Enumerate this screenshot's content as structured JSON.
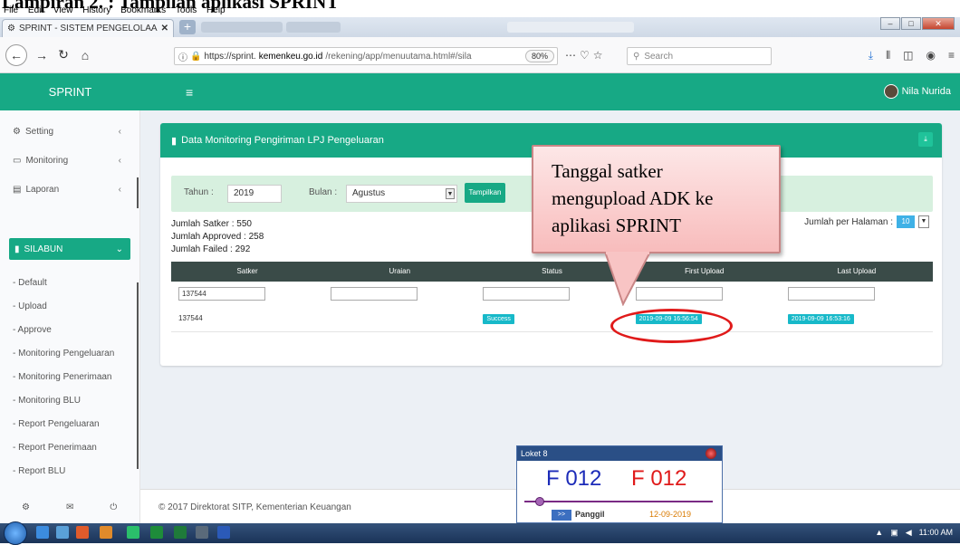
{
  "doc_heading": "Lampiran 2. : Tampilan aplikasi SPRINT",
  "menu": [
    "File",
    "Edit",
    "View",
    "History",
    "Bookmarks",
    "Tools",
    "Help"
  ],
  "browser": {
    "tab_title": "SPRINT - SISTEM PENGELOLAA",
    "url_prefix": "https://sprint.",
    "url_domain": "kemenkeu.go.id",
    "url_path": "/rekening/app/menuutama.html#/sila",
    "zoom": "80%",
    "search_placeholder": "Search"
  },
  "app": {
    "brand": "SPRINT",
    "user_name": "Nila Nurida"
  },
  "sidebar": {
    "items": [
      {
        "label": "Setting"
      },
      {
        "label": "Monitoring"
      },
      {
        "label": "Laporan"
      }
    ],
    "section": "SILABUN",
    "subitems": [
      "- Default",
      "- Upload",
      "- Approve",
      "- Monitoring Pengeluaran",
      "- Monitoring Penerimaan",
      "- Monitoring BLU",
      "- Report Pengeluaran",
      "- Report Penerimaan",
      "- Report BLU"
    ]
  },
  "panel": {
    "title": "Data Monitoring Pengiriman LPJ Pengeluaran",
    "tahun_label": "Tahun :",
    "tahun_value": "2019",
    "bulan_label": "Bulan :",
    "bulan_value": "Agustus",
    "show_button": "Tampilkan",
    "jumlah_satker": "Jumlah Satker : 550",
    "jumlah_approved": "Jumlah Approved : 258",
    "jumlah_failed": "Jumlah Failed : 292",
    "per_page_label": "Jumlah per Halaman :",
    "per_page_value": "10"
  },
  "table": {
    "columns": [
      "Satker",
      "Uraian",
      "Status",
      "First Upload",
      "Last Upload"
    ],
    "filter_satker": "137544",
    "rows": [
      {
        "satker": "137544",
        "uraian": "",
        "status": "Success",
        "first_upload": "2019-09-09 16:56:54",
        "last_upload": "2019-09-09 16:53:16"
      }
    ]
  },
  "footer": "© 2017 Direktorat SITP, Kementerian Keuangan",
  "callout": {
    "line1": "Tanggal satker",
    "line2": "mengupload ADK ke",
    "line3": "aplikasi SPRINT"
  },
  "loket": {
    "title": "Loket 8",
    "num1": "F 012",
    "num2": "F 012",
    "button": ">>",
    "button_label": "Panggil",
    "date": "12-09-2019"
  },
  "taskbar": {
    "time": "11:00 AM"
  },
  "colors": {
    "accent": "#17a985",
    "badge": "#17b9c9",
    "highlight": "#e01a1a"
  }
}
